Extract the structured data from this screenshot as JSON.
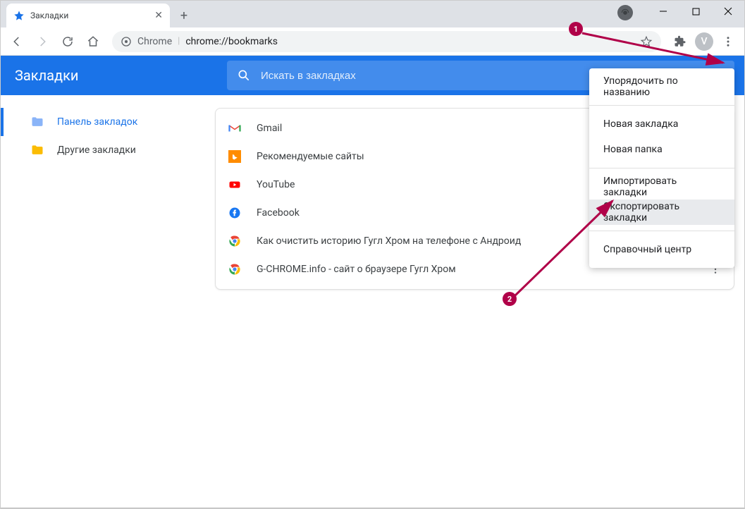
{
  "window": {
    "tab_title": "Закладки",
    "avatar_letter": "V"
  },
  "omnibox": {
    "hint": "Chrome",
    "url": "chrome://bookmarks"
  },
  "page": {
    "title": "Закладки",
    "search_placeholder": "Искать в закладках"
  },
  "sidebar": {
    "items": [
      {
        "label": "Панель закладок"
      },
      {
        "label": "Другие закладки"
      }
    ]
  },
  "bookmarks": [
    {
      "icon": "gmail",
      "label": "Gmail"
    },
    {
      "icon": "bing",
      "label": "Рекомендуемые сайты"
    },
    {
      "icon": "youtube",
      "label": "YouTube"
    },
    {
      "icon": "facebook",
      "label": "Facebook"
    },
    {
      "icon": "chrome",
      "label": "Как очистить историю Гугл Хром на телефоне с Андроид"
    },
    {
      "icon": "chrome",
      "label": "G-CHROME.info - сайт о браузере Гугл Хром"
    }
  ],
  "menu": {
    "sort": "Упорядочить по названию",
    "new_bookmark": "Новая закладка",
    "new_folder": "Новая папка",
    "import": "Импортировать закладки",
    "export": "Экспортировать закладки",
    "help": "Справочный центр"
  },
  "annotations": {
    "badge1": "1",
    "badge2": "2"
  },
  "colors": {
    "accent": "#1a73e8",
    "annotation": "#b00048"
  }
}
